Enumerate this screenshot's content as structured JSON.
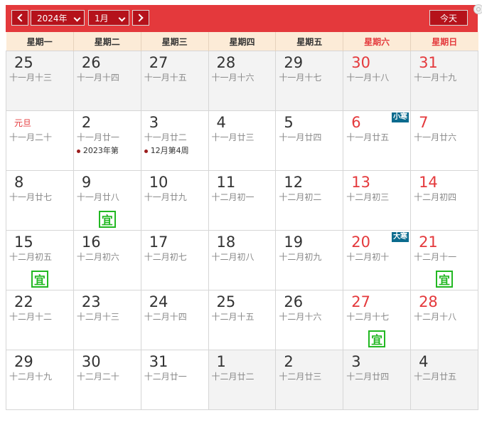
{
  "header": {
    "prev_icon": "chevron-left-icon",
    "year_select": "2024年",
    "month_select": "1月",
    "next_icon": "chevron-right-icon",
    "today_button": "今天"
  },
  "weekdays": [
    {
      "label": "星期一",
      "weekend": false
    },
    {
      "label": "星期二",
      "weekend": false
    },
    {
      "label": "星期三",
      "weekend": false
    },
    {
      "label": "星期四",
      "weekend": false
    },
    {
      "label": "星期五",
      "weekend": false
    },
    {
      "label": "星期六",
      "weekend": true
    },
    {
      "label": "星期日",
      "weekend": true
    }
  ],
  "colors": {
    "brand": "#e4393c",
    "weekend": "#e4393c",
    "auspicious": "#22b822",
    "term_badge": "#0b6b8e"
  },
  "weeks": [
    [
      {
        "day": "25",
        "lunar": "十一月十三",
        "other": true
      },
      {
        "day": "26",
        "lunar": "十一月十四",
        "other": true
      },
      {
        "day": "27",
        "lunar": "十一月十五",
        "other": true
      },
      {
        "day": "28",
        "lunar": "十一月十六",
        "other": true
      },
      {
        "day": "29",
        "lunar": "十一月十七",
        "other": true
      },
      {
        "day": "30",
        "lunar": "十一月十八",
        "other": true,
        "weekend": true
      },
      {
        "day": "31",
        "lunar": "十一月十九",
        "other": true,
        "weekend": true
      }
    ],
    [
      {
        "day": "",
        "festival": "元旦",
        "lunar": "十一月二十"
      },
      {
        "day": "2",
        "lunar": "十一月廿一",
        "event": "2023年第"
      },
      {
        "day": "3",
        "lunar": "十一月廿二",
        "event": "12月第4周"
      },
      {
        "day": "4",
        "lunar": "十一月廿三"
      },
      {
        "day": "5",
        "lunar": "十一月廿四"
      },
      {
        "day": "6",
        "lunar": "十一月廿五",
        "weekend": true,
        "term": "小寒"
      },
      {
        "day": "7",
        "lunar": "十一月廿六",
        "weekend": true
      }
    ],
    [
      {
        "day": "8",
        "lunar": "十一月廿七"
      },
      {
        "day": "9",
        "lunar": "十一月廿八",
        "yi": "宜"
      },
      {
        "day": "10",
        "lunar": "十一月廿九"
      },
      {
        "day": "11",
        "lunar": "十二月初一"
      },
      {
        "day": "12",
        "lunar": "十二月初二"
      },
      {
        "day": "13",
        "lunar": "十二月初三",
        "weekend": true
      },
      {
        "day": "14",
        "lunar": "十二月初四",
        "weekend": true
      }
    ],
    [
      {
        "day": "15",
        "lunar": "十二月初五",
        "yi": "宜"
      },
      {
        "day": "16",
        "lunar": "十二月初六"
      },
      {
        "day": "17",
        "lunar": "十二月初七"
      },
      {
        "day": "18",
        "lunar": "十二月初八"
      },
      {
        "day": "19",
        "lunar": "十二月初九"
      },
      {
        "day": "20",
        "lunar": "十二月初十",
        "weekend": true,
        "term": "大寒"
      },
      {
        "day": "21",
        "lunar": "十二月十一",
        "weekend": true,
        "yi": "宜"
      }
    ],
    [
      {
        "day": "22",
        "lunar": "十二月十二"
      },
      {
        "day": "23",
        "lunar": "十二月十三"
      },
      {
        "day": "24",
        "lunar": "十二月十四"
      },
      {
        "day": "25",
        "lunar": "十二月十五"
      },
      {
        "day": "26",
        "lunar": "十二月十六"
      },
      {
        "day": "27",
        "lunar": "十二月十七",
        "weekend": true,
        "yi": "宜"
      },
      {
        "day": "28",
        "lunar": "十二月十八",
        "weekend": true
      }
    ],
    [
      {
        "day": "29",
        "lunar": "十二月十九"
      },
      {
        "day": "30",
        "lunar": "十二月二十"
      },
      {
        "day": "31",
        "lunar": "十二月廿一"
      },
      {
        "day": "1",
        "lunar": "十二月廿二",
        "other": true
      },
      {
        "day": "2",
        "lunar": "十二月廿三",
        "other": true
      },
      {
        "day": "3",
        "lunar": "十二月廿四",
        "other": true
      },
      {
        "day": "4",
        "lunar": "十二月廿五",
        "other": true
      }
    ]
  ]
}
